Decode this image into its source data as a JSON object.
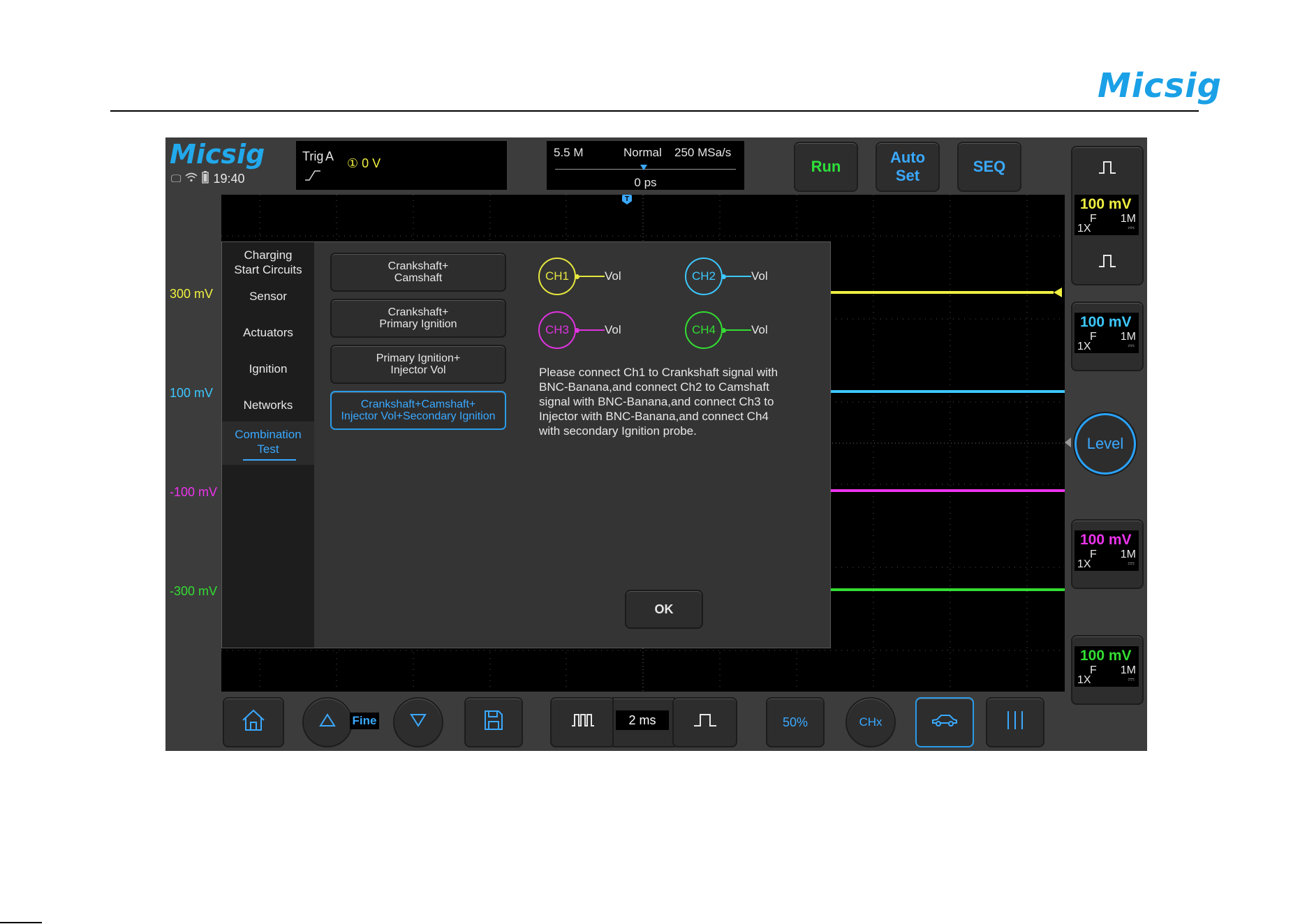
{
  "document": {
    "brand": "Micsig"
  },
  "app": {
    "brand": "Micsig",
    "time": "19:40"
  },
  "trigger": {
    "label": "Trig",
    "source": "A",
    "level": "① 0 V",
    "edge_icon": "rising-edge-icon"
  },
  "timebase_info": {
    "memory": "5.5 M",
    "mode": "Normal",
    "sample_rate": "250 MSa/s",
    "delay": "0 ps"
  },
  "toolbar": {
    "run": "Run",
    "auto_set_line1": "Auto",
    "auto_set_line2": "Set",
    "seq": "SEQ"
  },
  "scale_labels": [
    {
      "text": "300 mV",
      "color": "#f0f040"
    },
    {
      "text": "100 mV",
      "color": "#3cc8ff"
    },
    {
      "text": "-100 mV",
      "color": "#ee33ee"
    },
    {
      "text": "-300 mV",
      "color": "#33dd33"
    }
  ],
  "channels": [
    {
      "name": "CH1",
      "volts": "100 mV",
      "filter": "F",
      "impedance": "1M",
      "probe": "1X",
      "coupling": "⎓",
      "color": "#f0f040"
    },
    {
      "name": "CH2",
      "volts": "100 mV",
      "filter": "F",
      "impedance": "1M",
      "probe": "1X",
      "coupling": "⎓",
      "color": "#3cc8ff"
    },
    {
      "name": "CH3",
      "volts": "100 mV",
      "filter": "F",
      "impedance": "1M",
      "probe": "1X",
      "coupling": "⎓",
      "color": "#ee33ee"
    },
    {
      "name": "CH4",
      "volts": "100 mV",
      "filter": "F",
      "impedance": "1M",
      "probe": "1X",
      "coupling": "⎓",
      "color": "#33dd33"
    }
  ],
  "level_button": "Level",
  "bottom": {
    "fine": "Fine",
    "timebase": "2 ms",
    "half_label": "50%",
    "chx_label": "CHx"
  },
  "dialog": {
    "categories": [
      {
        "line1": "Charging",
        "line2": "Start Circuits"
      },
      {
        "line1": "Sensor",
        "line2": ""
      },
      {
        "line1": "Actuators",
        "line2": ""
      },
      {
        "line1": "Ignition",
        "line2": ""
      },
      {
        "line1": "Networks",
        "line2": ""
      },
      {
        "line1": "Combination",
        "line2": "Test"
      }
    ],
    "options": [
      {
        "line1": "Crankshaft+",
        "line2": "Camshaft"
      },
      {
        "line1": "Crankshaft+",
        "line2": "Primary Ignition"
      },
      {
        "line1": "Primary Ignition+",
        "line2": "Injector Vol"
      },
      {
        "line1": "Crankshaft+Camshaft+",
        "line2": "Injector Vol+Secondary Ignition"
      }
    ],
    "connections": [
      {
        "channel": "CH1",
        "signal": "Vol"
      },
      {
        "channel": "CH2",
        "signal": "Vol"
      },
      {
        "channel": "CH3",
        "signal": "Vol"
      },
      {
        "channel": "CH4",
        "signal": "Vol"
      }
    ],
    "message": "Please connect Ch1 to Crankshaft signal with BNC-Banana,and connect Ch2 to Camshaft signal with BNC-Banana,and connect Ch3 to Injector with BNC-Banana,and connect Ch4 with secondary Ignition probe.",
    "ok": "OK"
  }
}
